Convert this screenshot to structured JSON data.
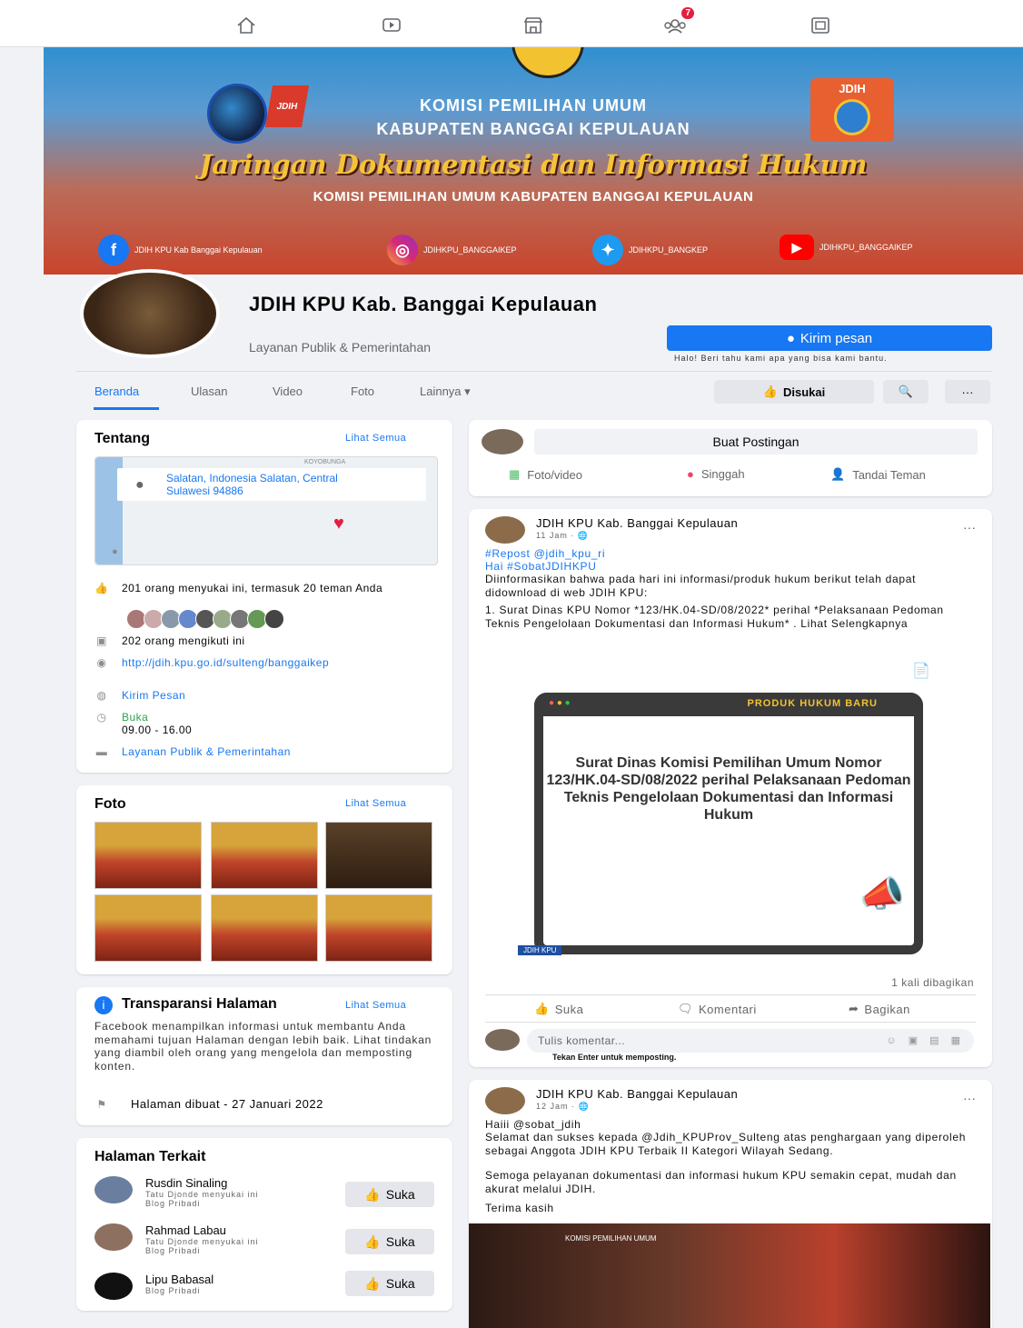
{
  "nav": {
    "notifications_badge": "7"
  },
  "cover": {
    "line1": "KOMISI PEMILIHAN UMUM",
    "line2": "KABUPATEN BANGGAI KEPULAUAN",
    "title": "Jaringan Dokumentasi dan Informasi Hukum",
    "subtitle": "KOMISI PEMILIHAN UMUM KABUPATEN BANGGAI KEPULAUAN",
    "badge": "JDIH",
    "badge_logo": "JDIH",
    "social": [
      {
        "label": "JDIH KPU Kab Banggai Kepulauan"
      },
      {
        "label": "JDIHKPU_BANGGAIKEP"
      },
      {
        "label": "JDIHKPU_BANGKEP"
      },
      {
        "label": "JDIHKPU_BANGGAIKEP"
      }
    ]
  },
  "profile": {
    "name": "JDIH KPU Kab. Banggai Kepulauan",
    "category": "Layanan Publik & Pemerintahan",
    "message_button": "Kirim pesan",
    "helper": "Halo! Beri tahu kami apa yang bisa kami bantu."
  },
  "tabs": [
    "Beranda",
    "Ulasan",
    "Video",
    "Foto",
    "Lainnya ▾"
  ],
  "liked_button": "Disukai",
  "about": {
    "title": "Tentang",
    "see_all": "Lihat Semua",
    "map_label": "KOYOBUNGA",
    "address": "Salatan, Indonesia Salatan, Central Sulawesi 94886",
    "likes": "201 orang menyukai ini, termasuk 20 teman Anda",
    "follows": "202 orang mengikuti ini",
    "website": "http://jdih.kpu.go.id/sulteng/banggaikep",
    "send_message": "Kirim Pesan",
    "open_label": "Buka",
    "hours": "09.00 - 16.00",
    "category": "Layanan Publik & Pemerintahan"
  },
  "photos": {
    "title": "Foto",
    "see_all": "Lihat Semua"
  },
  "transparency": {
    "title": "Transparansi Halaman",
    "see_all": "Lihat Semua",
    "text": "Facebook menampilkan informasi untuk membantu Anda memahami tujuan Halaman dengan lebih baik. Lihat tindakan yang diambil oleh orang yang mengelola dan memposting konten.",
    "created": "Halaman dibuat - 27 Januari 2022"
  },
  "related": {
    "title": "Halaman Terkait",
    "items": [
      {
        "name": "Rusdin Sinaling",
        "sub1": "Tatu Djonde menyukai ini",
        "sub2": "Blog Pribadi",
        "button": "Suka"
      },
      {
        "name": "Rahmad Labau",
        "sub1": "Tatu Djonde menyukai ini",
        "sub2": "Blog Pribadi",
        "button": "Suka"
      },
      {
        "name": "Lipu Babasal",
        "sub1": "Blog Pribadi",
        "button": "Suka"
      }
    ]
  },
  "composer": {
    "placeholder": "Buat Postingan",
    "actions": [
      "Foto/video",
      "Singgah",
      "Tandai Teman"
    ]
  },
  "post1": {
    "author": "JDIH KPU Kab. Banggai Kepulauan",
    "time": "11 Jam · 🌐",
    "l1": "#Repost @jdih_kpu_ri",
    "l2": "Hai #SobatJDIHKPU",
    "l3": "Diinformasikan bahwa pada hari ini informasi/produk hukum berikut telah dapat didownload di web JDIH KPU:",
    "l4": "1. Surat Dinas KPU Nomor *123/HK.04-SD/08/2022* perihal *Pelaksanaan Pedoman Teknis Pengelolaan Dokumentasi dan Informasi Hukum* . Lihat Selengkapnya",
    "card_header": "PRODUK HUKUM BARU",
    "card_text": "Surat Dinas Komisi Pemilihan Umum Nomor 123/HK.04-SD/08/2022 perihal Pelaksanaan Pedoman Teknis Pengelolaan Dokumentasi dan Informasi Hukum",
    "card_footer": "JDIH KPU",
    "shares": "1 kali dibagikan",
    "like": "Suka",
    "comment": "Komentari",
    "share": "Bagikan",
    "comment_placeholder": "Tulis komentar...",
    "hint": "Tekan Enter untuk memposting."
  },
  "post2": {
    "author": "JDIH KPU Kab. Banggai Kepulauan",
    "time": "12 Jam · 🌐",
    "l1": "Haiii @sobat_jdih",
    "l2": "Selamat dan sukses kepada @Jdih_KPUProv_Sulteng atas penghargaan yang diperoleh sebagai Anggota JDIH KPU Terbaik II Kategori Wilayah Sedang.",
    "l3": "Semoga pelayanan dokumentasi dan informasi hukum KPU semakin cepat, mudah dan akurat melalui JDIH.",
    "l4": "Terima kasih",
    "photo_caption": "KOMISI PEMILIHAN UMUM"
  },
  "colors": {
    "accent": "#1877f2",
    "badge": "#e41e3f"
  }
}
